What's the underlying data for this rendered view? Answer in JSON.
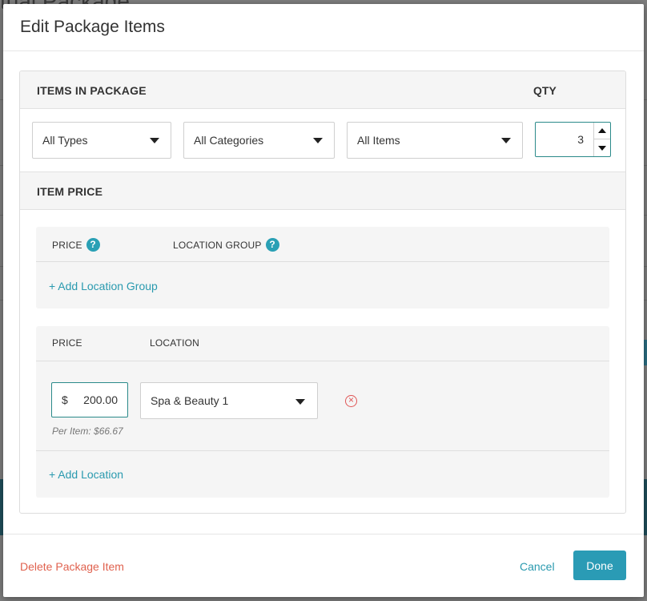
{
  "background": {
    "page_title": "tual Package"
  },
  "modal": {
    "title": "Edit Package Items"
  },
  "items_section": {
    "label": "ITEMS IN PACKAGE",
    "qty_label": "QTY",
    "type_filter": "All Types",
    "category_filter": "All Categories",
    "item_filter": "All Items",
    "qty_value": "3"
  },
  "price_section": {
    "label": "ITEM PRICE",
    "group_panel": {
      "price_col": "PRICE",
      "location_group_col": "LOCATION GROUP",
      "help_glyph": "?",
      "add_link": "+ Add Location Group"
    },
    "location_panel": {
      "price_col": "PRICE",
      "location_col": "LOCATION",
      "currency": "$",
      "price_value": "200.00",
      "location_value": "Spa & Beauty 1",
      "per_item": "Per Item: $66.67",
      "add_link": "+ Add Location"
    }
  },
  "footer": {
    "delete_label": "Delete Package Item",
    "cancel_label": "Cancel",
    "done_label": "Done"
  },
  "colors": {
    "accent": "#2a9bb5",
    "danger": "#e0624f",
    "focus_border": "#2b8a8a"
  },
  "icons": [
    "help-icon",
    "chevron-down-icon",
    "chevron-up-icon",
    "remove-circle-icon"
  ]
}
